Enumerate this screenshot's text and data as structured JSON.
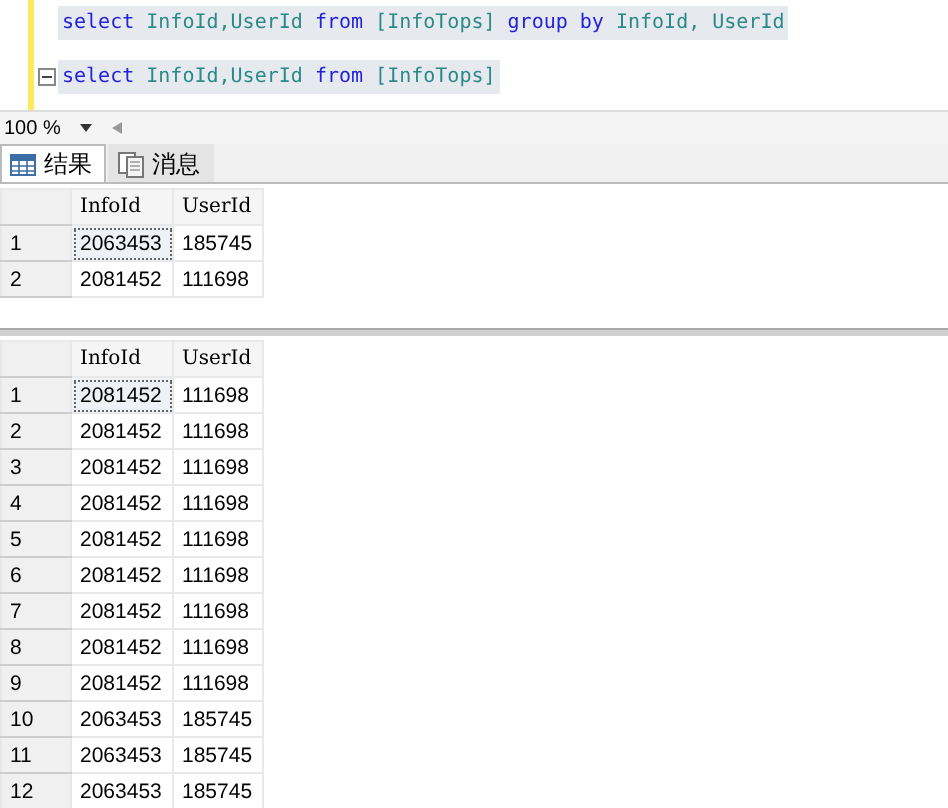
{
  "editor": {
    "lines": [
      {
        "collapsible": false,
        "tokens": [
          {
            "text": "select",
            "kind": "keyword"
          },
          {
            "text": " InfoId,UserId ",
            "kind": "ident"
          },
          {
            "text": "from",
            "kind": "keyword"
          },
          {
            "text": " [InfoTops] ",
            "kind": "ident"
          },
          {
            "text": "group by",
            "kind": "keyword"
          },
          {
            "text": " InfoId, UserId",
            "kind": "ident"
          }
        ]
      },
      {
        "collapsible": true,
        "tokens": [
          {
            "text": "select",
            "kind": "keyword"
          },
          {
            "text": " InfoId,UserId ",
            "kind": "ident"
          },
          {
            "text": "from",
            "kind": "keyword"
          },
          {
            "text": " [InfoTops]",
            "kind": "ident"
          }
        ]
      }
    ]
  },
  "zoom": {
    "value": "100 %"
  },
  "tabs": [
    {
      "label": "结果",
      "kind": "grid",
      "selected": true
    },
    {
      "label": "消息",
      "kind": "message",
      "selected": false
    }
  ],
  "grids": [
    {
      "columns": [
        "InfoId",
        "UserId"
      ],
      "rows": [
        {
          "number": "1",
          "focused": true,
          "cells": [
            "2063453",
            "185745"
          ]
        },
        {
          "number": "2",
          "focused": false,
          "cells": [
            "2081452",
            "111698"
          ]
        }
      ]
    },
    {
      "columns": [
        "InfoId",
        "UserId"
      ],
      "rows": [
        {
          "number": "1",
          "focused": true,
          "cells": [
            "2081452",
            "111698"
          ]
        },
        {
          "number": "2",
          "focused": false,
          "cells": [
            "2081452",
            "111698"
          ]
        },
        {
          "number": "3",
          "focused": false,
          "cells": [
            "2081452",
            "111698"
          ]
        },
        {
          "number": "4",
          "focused": false,
          "cells": [
            "2081452",
            "111698"
          ]
        },
        {
          "number": "5",
          "focused": false,
          "cells": [
            "2081452",
            "111698"
          ]
        },
        {
          "number": "6",
          "focused": false,
          "cells": [
            "2081452",
            "111698"
          ]
        },
        {
          "number": "7",
          "focused": false,
          "cells": [
            "2081452",
            "111698"
          ]
        },
        {
          "number": "8",
          "focused": false,
          "cells": [
            "2081452",
            "111698"
          ]
        },
        {
          "number": "9",
          "focused": false,
          "cells": [
            "2081452",
            "111698"
          ]
        },
        {
          "number": "10",
          "focused": false,
          "cells": [
            "2063453",
            "185745"
          ]
        },
        {
          "number": "11",
          "focused": false,
          "cells": [
            "2063453",
            "185745"
          ]
        },
        {
          "number": "12",
          "focused": false,
          "cells": [
            "2063453",
            "185745"
          ]
        }
      ]
    }
  ]
}
